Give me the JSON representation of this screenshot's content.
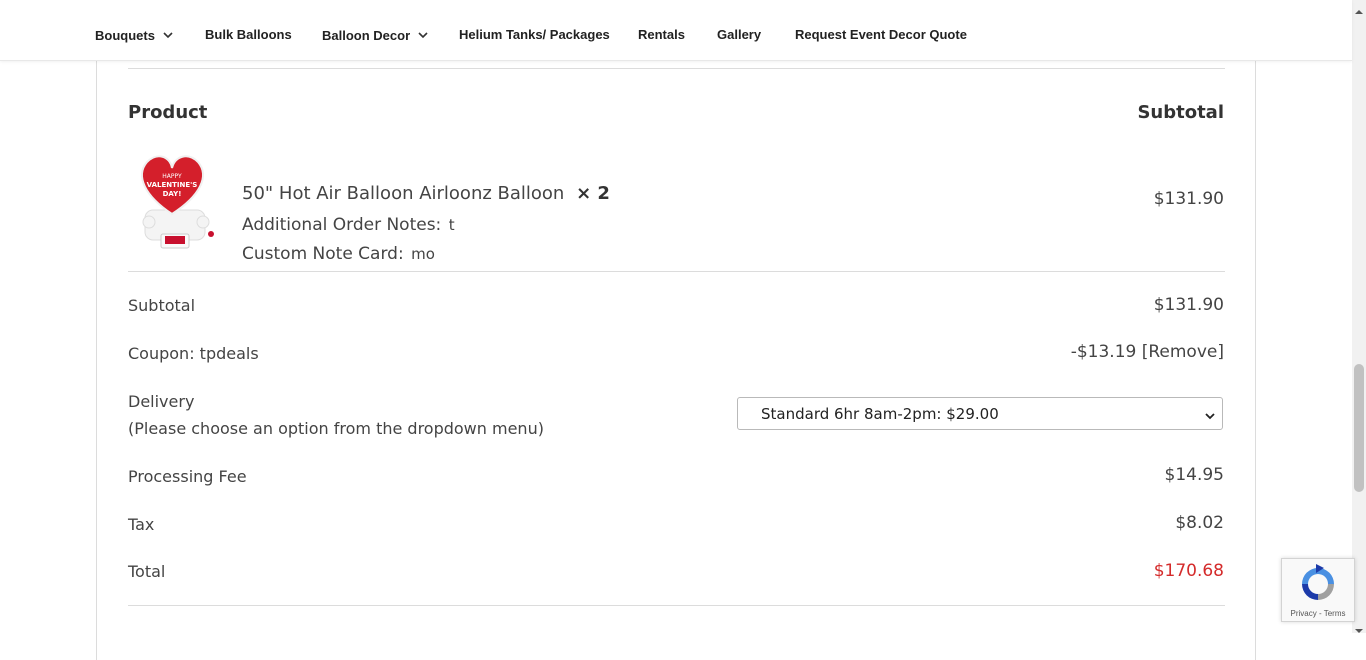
{
  "nav": {
    "items": [
      {
        "label": "Bouquets",
        "has_dropdown": true
      },
      {
        "label": "Bulk Balloons",
        "has_dropdown": false
      },
      {
        "label": "Balloon Decor",
        "has_dropdown": true
      },
      {
        "label": "Helium Tanks/ Packages",
        "has_dropdown": false
      },
      {
        "label": "Rentals",
        "has_dropdown": false
      },
      {
        "label": "Gallery",
        "has_dropdown": false
      },
      {
        "label": "Request Event Decor Quote",
        "has_dropdown": false
      }
    ]
  },
  "order": {
    "headers": {
      "product": "Product",
      "subtotal": "Subtotal"
    },
    "item": {
      "name": "50\" Hot Air Balloon Airloonz Balloon",
      "quantity": "× 2",
      "notes_label": "Additional Order Notes:",
      "notes_value": "t",
      "card_label": "Custom Note Card:",
      "card_value": "mo",
      "line_total": "$131.90",
      "image_text": "HAPPY VALENTINE'S DAY!"
    },
    "subtotal": {
      "label": "Subtotal",
      "value": "$131.90"
    },
    "coupon": {
      "label": "Coupon: tpdeals",
      "value": "-$13.19",
      "remove_label": "[Remove]"
    },
    "delivery": {
      "label": "Delivery",
      "hint": "(Please choose an option from the dropdown menu)",
      "selected": "Standard 6hr 8am-2pm: $29.00"
    },
    "processing_fee": {
      "label": "Processing Fee",
      "value": "$14.95"
    },
    "tax": {
      "label": "Tax",
      "value": "$8.02"
    },
    "total": {
      "label": "Total",
      "value": "$170.68"
    }
  },
  "recaptcha": {
    "links": "Privacy - Terms"
  },
  "colors": {
    "total": "#d42b2b",
    "accent": "#c8102e"
  },
  "icons": [
    "chevron-down-icon",
    "recaptcha-logo-icon"
  ]
}
